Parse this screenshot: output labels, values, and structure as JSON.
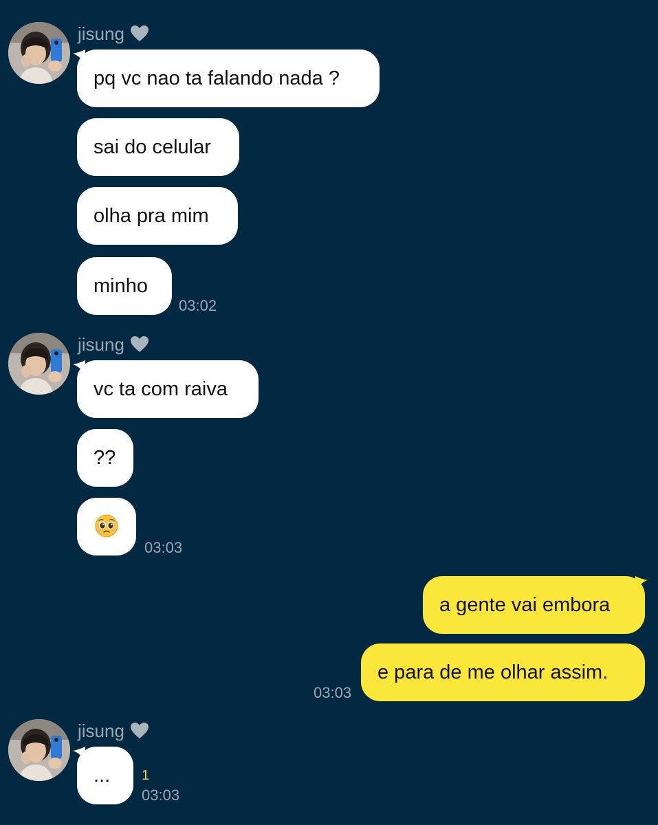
{
  "contact": {
    "name": "jisung",
    "heart_icon": "grey-heart-icon"
  },
  "groups": [
    {
      "sender": "jisung",
      "messages": [
        "pq vc nao ta falando nada ?",
        "sai do celular",
        "olha pra mim",
        "minho"
      ],
      "time": "03:02"
    },
    {
      "sender": "jisung",
      "messages": [
        "vc ta com raiva",
        "??",
        "pleading-face-emoji"
      ],
      "time": "03:03"
    },
    {
      "sender": "me",
      "messages": [
        "a gente vai embora",
        "e para de me olhar assim."
      ],
      "time": "03:03"
    },
    {
      "sender": "jisung",
      "messages": [
        "..."
      ],
      "unread_count": "1",
      "time": "03:03"
    }
  ],
  "colors": {
    "background": "#032841",
    "incoming_bubble": "#ffffff",
    "outgoing_bubble": "#fbe739",
    "timestamp": "#9aa7b1",
    "unread": "#f4d63a"
  }
}
